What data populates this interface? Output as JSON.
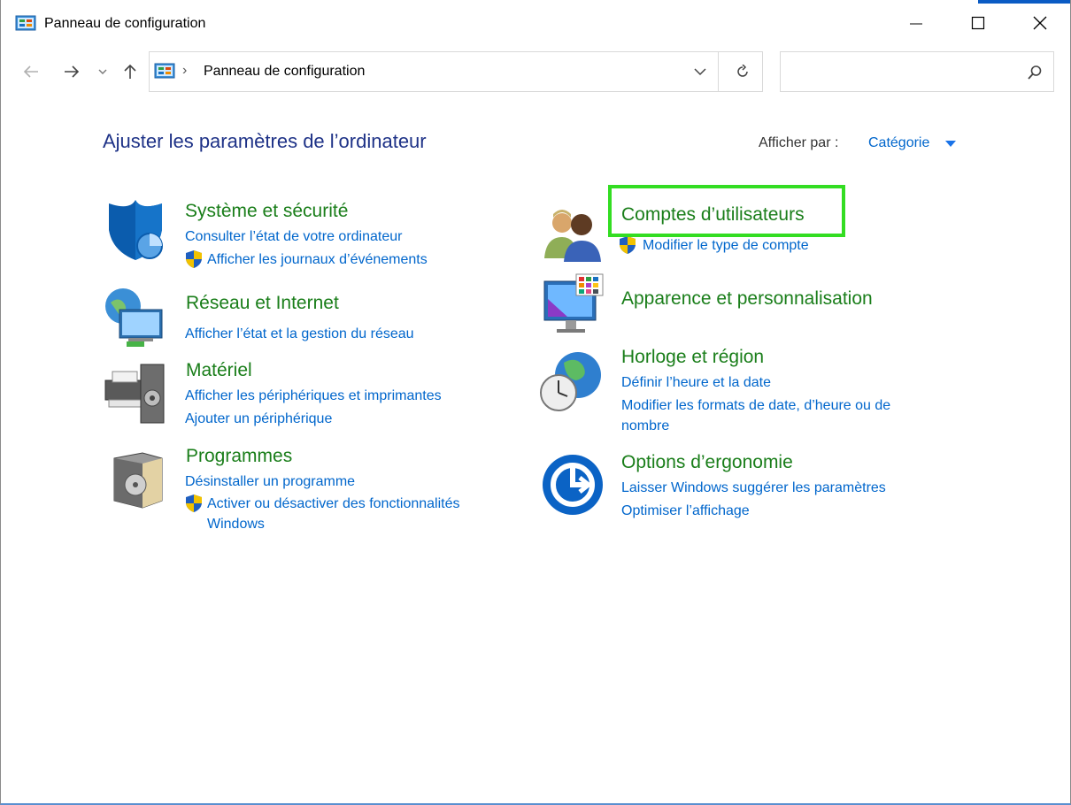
{
  "window": {
    "title": "Panneau de configuration"
  },
  "address": {
    "separator": "›",
    "path": "Panneau de configuration"
  },
  "search": {
    "placeholder": ""
  },
  "header": {
    "title": "Ajuster les paramètres de l’ordinateur",
    "view_label": "Afficher par :",
    "view_value": "Catégorie"
  },
  "categories": {
    "system": {
      "title": "Système et sécurité",
      "links": [
        "Consulter l’état de votre ordinateur",
        "Afficher les journaux d’événements"
      ]
    },
    "network": {
      "title": "Réseau et Internet",
      "links": [
        "Afficher l’état et la gestion du réseau"
      ]
    },
    "hardware": {
      "title": "Matériel",
      "links": [
        "Afficher les périphériques et imprimantes",
        "Ajouter un périphérique"
      ]
    },
    "programs": {
      "title": "Programmes",
      "links": [
        "Désinstaller un programme",
        "Activer ou désactiver des fonctionnalités",
        "Windows"
      ]
    },
    "accounts": {
      "title": "Comptes d’utilisateurs",
      "links": [
        "Modifier le type de compte"
      ]
    },
    "appearance": {
      "title": "Apparence et personnalisation",
      "links": []
    },
    "clock": {
      "title": "Horloge et région",
      "links": [
        "Définir l’heure et la date",
        "Modifier les formats de date, d’heure ou de",
        "nombre"
      ]
    },
    "ease": {
      "title": "Options d’ergonomie",
      "links": [
        "Laisser Windows suggérer les paramètres",
        "Optimiser l’affichage"
      ]
    }
  },
  "colors": {
    "title_blue": "#1e3287",
    "category_green": "#1a7e1a",
    "link_blue": "#0066cc",
    "highlight_green": "#33dd22"
  },
  "icons": {
    "app": "control-panel-icon",
    "back": "back-arrow-icon",
    "forward": "forward-arrow-icon",
    "recent": "chevron-down-icon",
    "up": "up-arrow-icon",
    "refresh": "refresh-icon",
    "search": "search-icon"
  }
}
